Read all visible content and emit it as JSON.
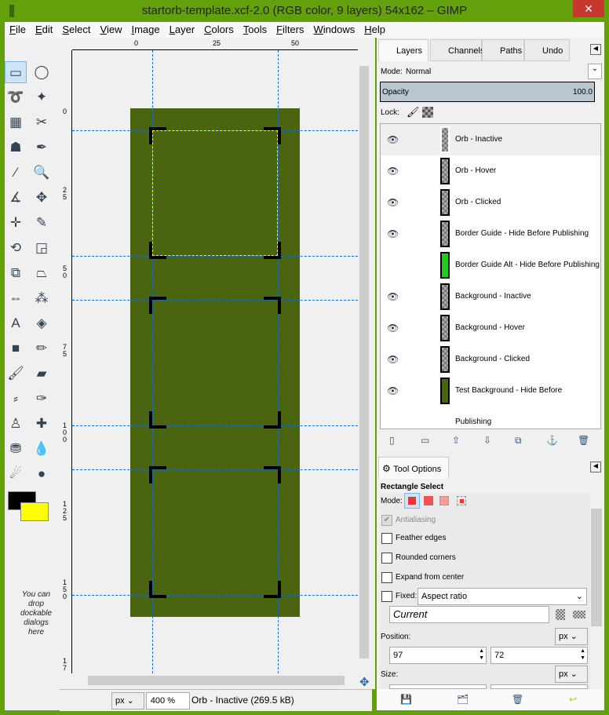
{
  "window": {
    "title": "startorb-template.xcf-2.0 (RGB color, 9 layers) 54x162 – GIMP",
    "close": "✕"
  },
  "menu": [
    "File",
    "Edit",
    "Select",
    "View",
    "Image",
    "Layer",
    "Colors",
    "Tools",
    "Filters",
    "Windows",
    "Help"
  ],
  "tools": [
    [
      "rect-select",
      "▭"
    ],
    [
      "ellipse-select",
      "◯"
    ],
    [
      "free-select",
      "➰"
    ],
    [
      "fuzzy-select",
      "✦"
    ],
    [
      "select-by-color",
      "▦"
    ],
    [
      "scissors",
      "✂"
    ],
    [
      "foreground-select",
      "☗"
    ],
    [
      "paths",
      "✒"
    ],
    [
      "color-picker",
      "⁄"
    ],
    [
      "zoom",
      "🔍"
    ],
    [
      "measure",
      "∡"
    ],
    [
      "move",
      "✥"
    ],
    [
      "align",
      "✛"
    ],
    [
      "crop",
      "✎"
    ],
    [
      "rotate",
      "⟲"
    ],
    [
      "scale",
      "◲"
    ],
    [
      "shear",
      "⧉"
    ],
    [
      "perspective",
      "⏢"
    ],
    [
      "flip",
      "⇔"
    ],
    [
      "cage",
      "⁂"
    ],
    [
      "text",
      "A"
    ],
    [
      "bucket-fill",
      "◈"
    ],
    [
      "blend",
      "■"
    ],
    [
      "pencil",
      "✏"
    ],
    [
      "paintbrush",
      "🖌"
    ],
    [
      "eraser",
      "▰"
    ],
    [
      "airbrush",
      "⸗"
    ],
    [
      "ink",
      "✑"
    ],
    [
      "clone",
      "♙"
    ],
    [
      "heal",
      "✚"
    ],
    [
      "perspective-clone",
      "⛃"
    ],
    [
      "blur",
      "💧"
    ],
    [
      "smudge",
      "☄"
    ],
    [
      "dodge-burn",
      "●"
    ]
  ],
  "toolbox": {
    "drop_hint": "You can drop dockable dialogs here",
    "fg_color": "#000000",
    "bg_color": "#ffff00"
  },
  "rulers": {
    "h": [
      "0",
      "25",
      "50"
    ],
    "v": [
      "0",
      "2 5",
      "5 0",
      "7 5",
      "1 0 0",
      "1 2 5",
      "1 5 0",
      "1 7"
    ]
  },
  "canvas": {
    "image_color": "#4a6410",
    "guide_color": "#0a70e6"
  },
  "status": {
    "unit": "px",
    "zoom": "400 %",
    "info": "Orb - Inactive (269.5 kB)"
  },
  "dock": {
    "tabs": [
      "Layers",
      "Channels",
      "Paths",
      "Undo"
    ],
    "mode_label": "Mode:",
    "mode_value": "Normal",
    "opacity_label": "Opacity",
    "opacity_value": "100.0",
    "lock_label": "Lock:",
    "layers": [
      {
        "name": "Orb - Inactive",
        "visible": true,
        "selected": true
      },
      {
        "name": "Orb - Hover",
        "visible": true
      },
      {
        "name": "Orb - Clicked",
        "visible": true
      },
      {
        "name": "Border Guide - Hide Before Publishing",
        "visible": true
      },
      {
        "name": "Border Guide Alt - Hide Before Publishing",
        "visible": false,
        "thumb": "green"
      },
      {
        "name": "Background - Inactive",
        "visible": true
      },
      {
        "name": "Background - Hover",
        "visible": true
      },
      {
        "name": "Background - Clicked",
        "visible": true
      },
      {
        "name": "Test Background - Hide Before Publishing",
        "visible": true,
        "thumb": "solid"
      }
    ],
    "layer_buttons": [
      [
        "new-layer",
        "▯"
      ],
      [
        "layer-group",
        "▭"
      ],
      [
        "raise-layer",
        "⇧"
      ],
      [
        "lower-layer",
        "⇩"
      ],
      [
        "duplicate-layer",
        "⧉"
      ],
      [
        "anchor-layer",
        "⚓"
      ],
      [
        "delete-layer",
        "🗑"
      ]
    ]
  },
  "tool_options": {
    "tab": "Tool Options",
    "title": "Rectangle Select",
    "mode_label": "Mode:",
    "antialiasing": "Antialiasing",
    "feather": "Feather edges",
    "rounded": "Rounded corners",
    "expand": "Expand from center",
    "fixed": "Fixed:",
    "fixed_value": "Aspect ratio",
    "current": "Current",
    "position_label": "Position:",
    "position_unit": "px",
    "pos_x": "97",
    "pos_y": "72",
    "size_label": "Size:",
    "size_unit": "px"
  }
}
